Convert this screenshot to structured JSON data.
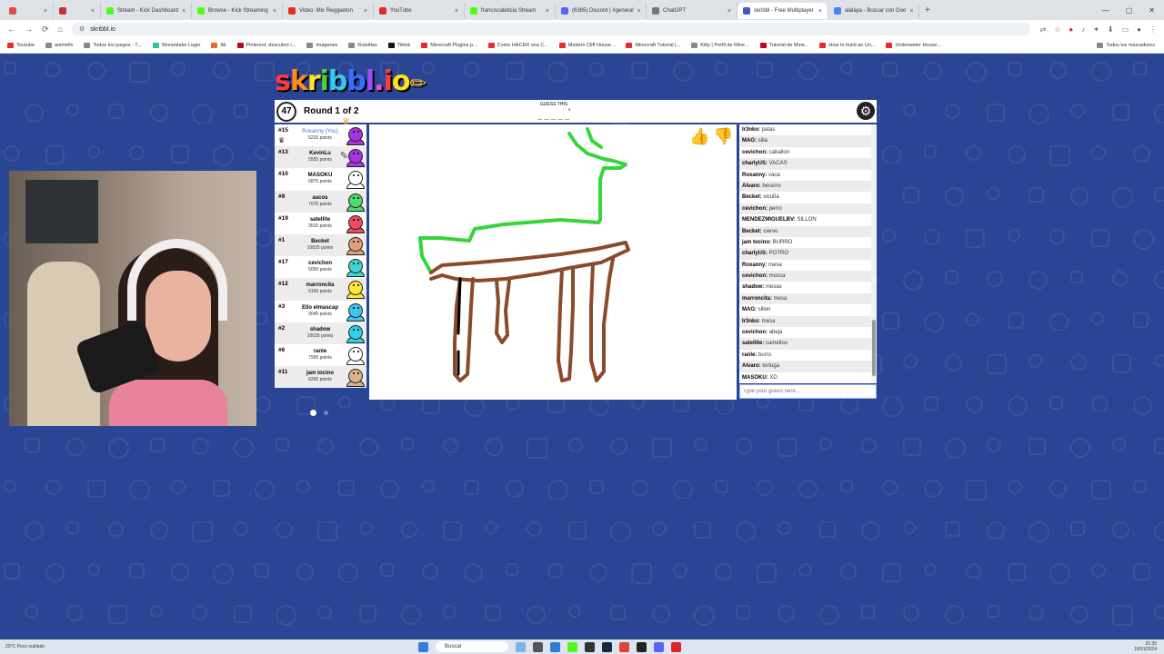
{
  "browser": {
    "tabs": [
      {
        "label": "",
        "color": "#e34b4b"
      },
      {
        "label": "",
        "color": "#c7323b"
      },
      {
        "label": "Stream - Kick Dashboard",
        "color": "#53fc18"
      },
      {
        "label": "Browse - Kick Streaming",
        "color": "#53fc18"
      },
      {
        "label": "Video: Mix Reggaeton",
        "color": "#e52d27"
      },
      {
        "label": "YouTube",
        "color": "#e52d27"
      },
      {
        "label": "franciscaleticia Stream",
        "color": "#53fc18"
      },
      {
        "label": "(6365) Discord | #general",
        "color": "#5865f2"
      },
      {
        "label": "ChatGPT",
        "color": "#777777"
      },
      {
        "label": "skribbl - Free Multiplayer",
        "color": "#3d58c7",
        "active": true
      },
      {
        "label": "alalaya - Buscar con Goo",
        "color": "#4285f4"
      }
    ],
    "url": "skribbl.io",
    "bookmarks": [
      {
        "label": "Youtube",
        "color": "#e52d27"
      },
      {
        "label": "animeflv",
        "color": "#888888"
      },
      {
        "label": "Todos los juegos - T...",
        "color": "#888888"
      },
      {
        "label": "Streamlabs Login",
        "color": "#31c3a2"
      },
      {
        "label": "Ali",
        "color": "#e86a2c"
      },
      {
        "label": "Pinterest: descubre i...",
        "color": "#bd081c"
      },
      {
        "label": "Imagenes",
        "color": "#888888"
      },
      {
        "label": "Ruletitas",
        "color": "#888888"
      },
      {
        "label": "Tiktok",
        "color": "#111111"
      },
      {
        "label": "Minecraft Plugins p...",
        "color": "#e52d27"
      },
      {
        "label": "Como HACER una C...",
        "color": "#e52d27"
      },
      {
        "label": "Modern Cliff House...",
        "color": "#e52d27"
      },
      {
        "label": "Minecraft Tutorial |...",
        "color": "#e52d27"
      },
      {
        "label": "Kitty | Perfil de Mine...",
        "color": "#888888"
      },
      {
        "label": "Tutorial de Mine...",
        "color": "#bd081c"
      },
      {
        "label": "How to build an Un...",
        "color": "#e52d27"
      },
      {
        "label": "Underwater House...",
        "color": "#e52d27"
      }
    ],
    "bookmarks_right": "Todos los marcadores"
  },
  "logo": {
    "letters": [
      {
        "ch": "s",
        "color": "#ff3b3b"
      },
      {
        "ch": "k",
        "color": "#ff8a1d"
      },
      {
        "ch": "r",
        "color": "#ffe21a"
      },
      {
        "ch": "i",
        "color": "#46d52c"
      },
      {
        "ch": "b",
        "color": "#36c9ef"
      },
      {
        "ch": "b",
        "color": "#3a6cff"
      },
      {
        "ch": "l",
        "color": "#a34cff"
      },
      {
        "ch": ".",
        "color": "#ff50b5"
      },
      {
        "ch": "i",
        "color": "#ff3b3b"
      },
      {
        "ch": "o",
        "color": "#ffe21a"
      }
    ]
  },
  "game": {
    "timer": "47",
    "round": "Round 1 of 2",
    "guess_label": "GUESS THIS",
    "word_length": "5",
    "word_blanks": "_ _ _ _ _"
  },
  "players": [
    {
      "rank": "#15",
      "name": "Roxanny (You)",
      "points": "5210 points",
      "you": true,
      "color": "#a634e0",
      "owner": true
    },
    {
      "rank": "#13",
      "name": "KevinLu",
      "points": "5555 points",
      "color": "#a634e0",
      "drawing": true
    },
    {
      "rank": "#10",
      "name": "MASOKU",
      "points": "6875 points",
      "color": "#ffffff"
    },
    {
      "rank": "#9",
      "name": "ascos",
      "points": "7075 points",
      "color": "#4fd86b"
    },
    {
      "rank": "#19",
      "name": "satellite",
      "points": "3510 points",
      "color": "#ef4b62"
    },
    {
      "rank": "#1",
      "name": "Becket",
      "points": "10825 points",
      "color": "#e0a27d"
    },
    {
      "rank": "#17",
      "name": "cevichon",
      "points": "5000 points",
      "color": "#3fd5d0"
    },
    {
      "rank": "#12",
      "name": "marroncita",
      "points": "6195 points",
      "color": "#ffe73a"
    },
    {
      "rank": "#3",
      "name": "Ello elmascap",
      "points": "9045 points",
      "color": "#3fc8ec"
    },
    {
      "rank": "#2",
      "name": "shadow",
      "points": "10035 points",
      "color": "#2ecfe8"
    },
    {
      "rank": "#6",
      "name": "ranle",
      "points": "7905 points",
      "color": "#ffffff"
    },
    {
      "rank": "#11",
      "name": "jam tocino",
      "points": "6200 points",
      "color": "#d9b38c"
    }
  ],
  "bubble": "XD",
  "chat": [
    {
      "user": "Ir3nko:",
      "text": " patas"
    },
    {
      "user": "MAG:",
      "text": " silla"
    },
    {
      "user": "cevichon:",
      "text": " caballon"
    },
    {
      "user": "charlyUS:",
      "text": " VACAS"
    },
    {
      "user": "Roxanny:",
      "text": " vaca"
    },
    {
      "user": "Alvaro:",
      "text": " becerro"
    },
    {
      "user": "Becket:",
      "text": " vicuña"
    },
    {
      "user": "cevichon:",
      "text": " perro"
    },
    {
      "user": "MENDEZMIGUELBV:",
      "text": " SILLON"
    },
    {
      "user": "Becket:",
      "text": " ciervo"
    },
    {
      "user": "jam tocino:",
      "text": " BURRO"
    },
    {
      "user": "charlyUS:",
      "text": " POTRO"
    },
    {
      "user": "Roxanny:",
      "text": " mesa"
    },
    {
      "user": "cevichon:",
      "text": " mosca"
    },
    {
      "user": "shadow:",
      "text": " mesas"
    },
    {
      "user": "marroncita:",
      "text": " mesa"
    },
    {
      "user": "MAG:",
      "text": " sillon"
    },
    {
      "user": "Ir3nko:",
      "text": " mesa"
    },
    {
      "user": "cevichon:",
      "text": " abeja"
    },
    {
      "user": "satellite:",
      "text": " camelloo"
    },
    {
      "user": "ranle:",
      "text": " burro"
    },
    {
      "user": "Alvaro:",
      "text": " tortuga"
    },
    {
      "user": "MASOKU:",
      "text": " XD"
    }
  ],
  "chat_placeholder": "Type your guess here...",
  "taskbar": {
    "weather_temp": "23°C",
    "weather_desc": "Poco nublado",
    "search": "Buscar",
    "lang": "ESP\nLAA",
    "time": "21:35",
    "date": "16/01/2024"
  },
  "colors": {
    "page_bg": "#2a4593",
    "stroke_green": "#36d63a",
    "stroke_brown": "#8b4b2a"
  }
}
